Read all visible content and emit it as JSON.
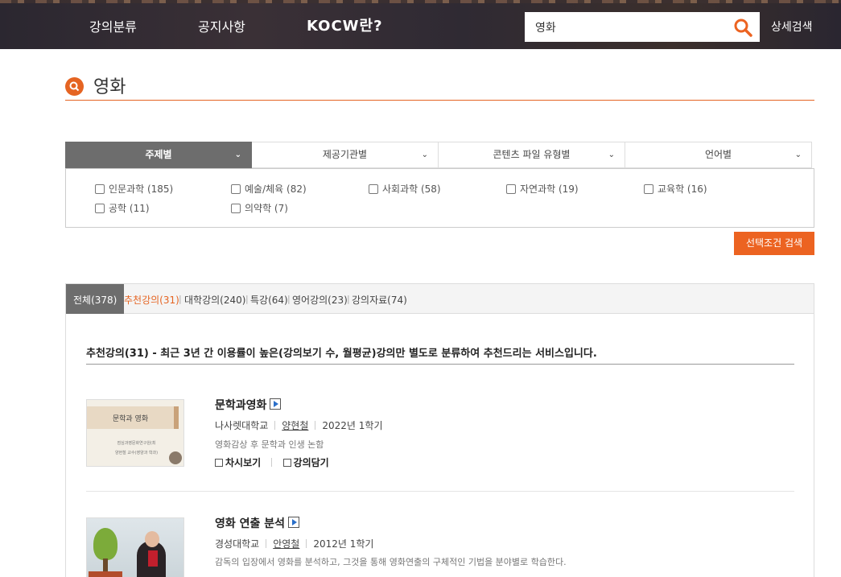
{
  "header": {
    "nav_category": "강의분류",
    "nav_notice": "공지사항",
    "nav_about": "KOCW란?",
    "search_value": "영화",
    "advanced_search": "상세검색"
  },
  "page": {
    "title": "영화"
  },
  "filter": {
    "tabs": [
      {
        "label": "주제별"
      },
      {
        "label": "제공기관별"
      },
      {
        "label": "콘텐츠 파일 유형별"
      },
      {
        "label": "언어별"
      }
    ],
    "options": [
      {
        "label": "인문과학 (185)"
      },
      {
        "label": "예술/체육 (82)"
      },
      {
        "label": "사회과학 (58)"
      },
      {
        "label": "자연과학 (19)"
      },
      {
        "label": "교육학 (16)"
      },
      {
        "label": "공학 (11)"
      },
      {
        "label": "의약학 (7)"
      }
    ],
    "search_button": "선택조건 검색"
  },
  "results": {
    "tabs": [
      {
        "label": "전체(378)"
      },
      {
        "label": "추천강의(31)"
      },
      {
        "label": "대학강의(240)"
      },
      {
        "label": "특강(64)"
      },
      {
        "label": "영어강의(23)"
      },
      {
        "label": "강의자료(74)"
      }
    ],
    "notice": "추천강의(31) - 최근 3년 간 이용률이 높은(강의보기 수, 월평균)강의만 별도로 분류하여 추천드리는 서비스입니다.",
    "courses": [
      {
        "title": "문학과영화",
        "school": "나사렛대학교",
        "professor": "양현철",
        "term": "2022년 1학기",
        "desc": "영화감상 후 문학과 인생 논함",
        "thumb_title": "문학과 영화",
        "thumb_line1": "점심과영문화연구원(최",
        "thumb_line2": "양현철 교수(영양과 학과)"
      },
      {
        "title": "영화 연출 분석",
        "school": "경성대학교",
        "professor": "안영철",
        "term": "2012년 1학기",
        "desc": "감독의 입장에서 영화를 분석하고, 그것을 통해 영화연출의 구체적인 기법을 분야별로 학습한다."
      }
    ],
    "action_list": "차시보기",
    "action_save": "강의담기"
  },
  "colors": {
    "accent": "#e56422",
    "tab_active": "#6d6d6d"
  }
}
